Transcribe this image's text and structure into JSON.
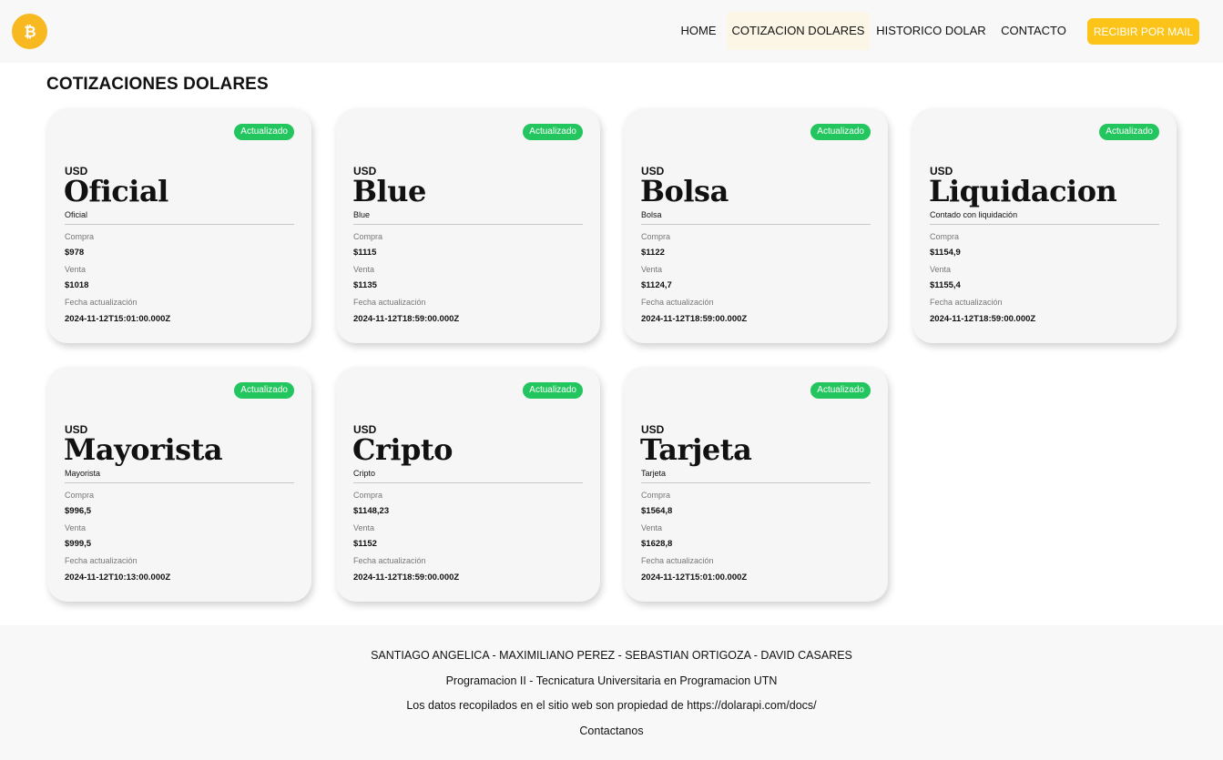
{
  "nav": {
    "items": [
      {
        "label": "HOME"
      },
      {
        "label": "COTIZACION DOLARES"
      },
      {
        "label": "HISTORICO DOLAR"
      },
      {
        "label": "CONTACTO"
      }
    ],
    "cta_label": "RECIBIR POR MAIL",
    "logo_icon": "bitcoin-icon",
    "accent_color": "#fcc419"
  },
  "page": {
    "title": "COTIZACIONES DOLARES"
  },
  "labels": {
    "currency": "USD",
    "buy": "Compra",
    "sell": "Venta",
    "date": "Fecha actualización",
    "badge": "Actualizado"
  },
  "cards": [
    {
      "name": "Oficial",
      "subtitle": "Oficial",
      "buy": "$978",
      "sell": "$1018",
      "date": "2024-11-12T15:01:00.000Z"
    },
    {
      "name": "Blue",
      "subtitle": "Blue",
      "buy": "$1115",
      "sell": "$1135",
      "date": "2024-11-12T18:59:00.000Z"
    },
    {
      "name": "Bolsa",
      "subtitle": "Bolsa",
      "buy": "$1122",
      "sell": "$1124,7",
      "date": "2024-11-12T18:59:00.000Z"
    },
    {
      "name": "Liquidacion",
      "subtitle": "Contado con liquidación",
      "buy": "$1154,9",
      "sell": "$1155,4",
      "date": "2024-11-12T18:59:00.000Z"
    },
    {
      "name": "Mayorista",
      "subtitle": "Mayorista",
      "buy": "$996,5",
      "sell": "$999,5",
      "date": "2024-11-12T10:13:00.000Z"
    },
    {
      "name": "Cripto",
      "subtitle": "Cripto",
      "buy": "$1148,23",
      "sell": "$1152",
      "date": "2024-11-12T18:59:00.000Z"
    },
    {
      "name": "Tarjeta",
      "subtitle": "Tarjeta",
      "buy": "$1564,8",
      "sell": "$1628,8",
      "date": "2024-11-12T15:01:00.000Z"
    }
  ],
  "footer": {
    "authors": "SANTIAGO ANGELICA - MAXIMILIANO PEREZ - SEBASTIAN ORTIGOZA - DAVID CASARES",
    "course": "Programacion II - Tecnicatura Universitaria en Programacion UTN",
    "source": "Los datos recopilados en el sitio web son propiedad de https://dolarapi.com/docs/",
    "contact": "Contactanos"
  }
}
